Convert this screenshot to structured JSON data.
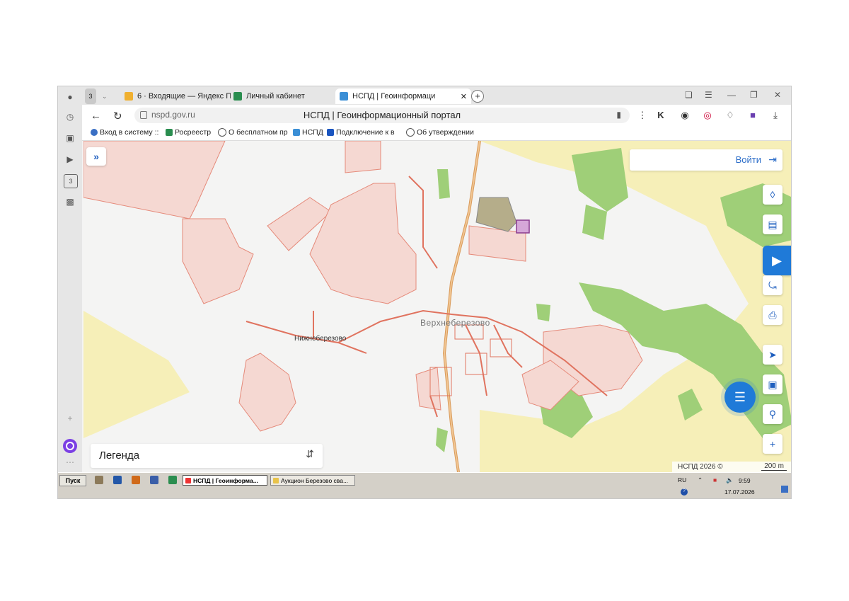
{
  "browser": {
    "tabs": [
      {
        "label": "6 · Входящие — Яндекс П",
        "icon": "mail-icon"
      },
      {
        "label": "Личный кабинет",
        "icon": "rosreestr-icon"
      },
      {
        "label": "НСПД | Геоинформаци",
        "icon": "nspd-icon",
        "active": true
      }
    ],
    "tab_count_badge": "3",
    "url_domain": "nspd.gov.ru",
    "page_title": "НСПД | Геоинформационный портал",
    "bookmarks": [
      "Вход в систему ::",
      "Росреестр",
      "О бесплатном пр",
      "НСПД",
      "Подключение к в",
      "Об утверждении"
    ],
    "rail_badge": "3"
  },
  "map": {
    "login_label": "Войти",
    "legend_label": "Легенда",
    "attribution": "НСПД 2026 ©",
    "scale_label": "200 m",
    "places": [
      "Верхнеберезово",
      "Нижнеберезово"
    ]
  },
  "taskbar": {
    "start_label": "Пуск",
    "tasks": [
      "НСПД | Геоинформа...",
      "Аукцион Березово  сва..."
    ],
    "lang": "RU",
    "time": "9:59",
    "date": "17.07.2026"
  },
  "colors": {
    "parcel_fill": "#f5d8d2",
    "parcel_stroke": "#e58a7a",
    "road": "#e0735f",
    "forest": "#9fcf78",
    "field": "#f6efb8",
    "accent": "#1f7ad8"
  }
}
